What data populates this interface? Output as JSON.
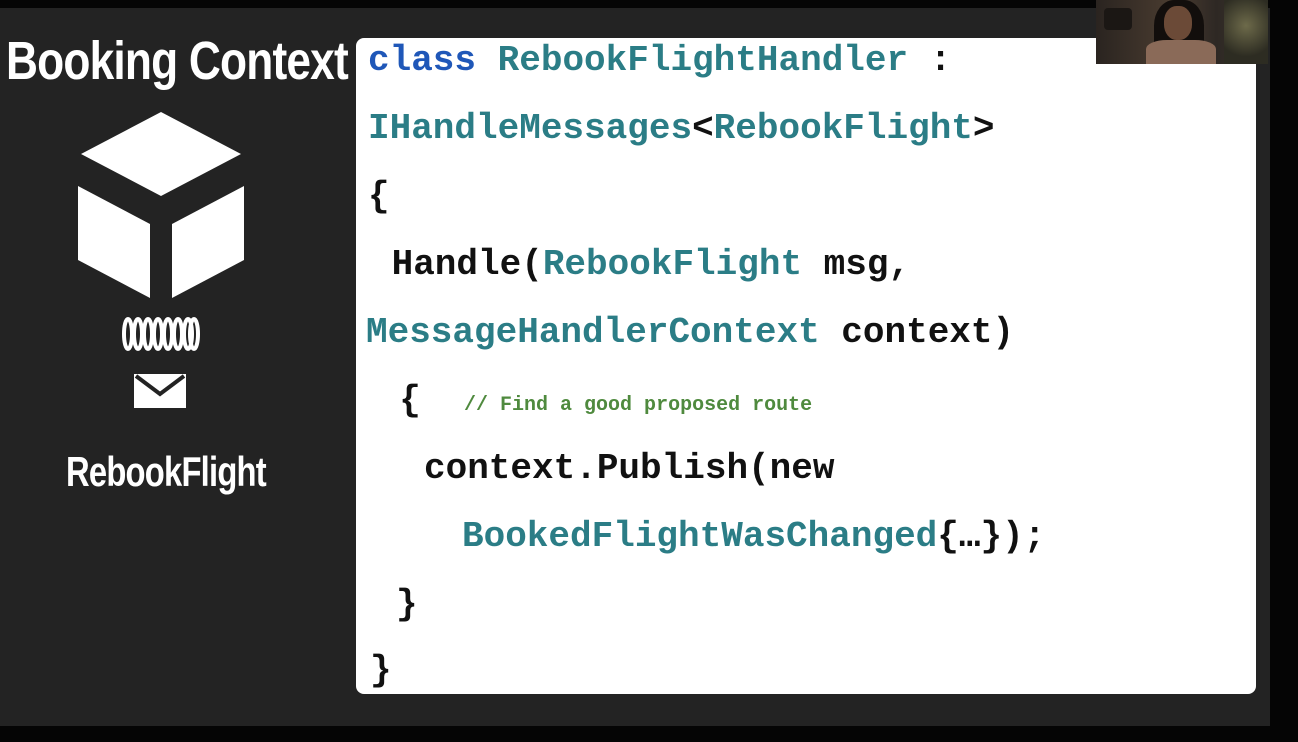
{
  "slide": {
    "title": "Booking Context",
    "message_label": "RebookFlight"
  },
  "code": {
    "line1": {
      "kw": "class",
      "type": "RebookFlightHandler",
      "rest": " :"
    },
    "line2": {
      "type": "IHandleMessages",
      "open": "<",
      "generic": "RebookFlight",
      "close": ">"
    },
    "line3": "{",
    "line4": {
      "pre": " Handle(",
      "type": "RebookFlight",
      "rest": " msg,"
    },
    "line5": {
      "type": "MessageHandlerContext",
      "rest": " context)"
    },
    "line6": {
      "brace": "  {",
      "comment": "// Find a good proposed route"
    },
    "line7": "context.Publish(new",
    "line8": {
      "type": "BookedFlightWasChanged",
      "rest": "{…});"
    },
    "line9": "}",
    "line10": "}"
  },
  "colors": {
    "keyword": "#1f57b8",
    "type": "#2b7d86",
    "comment": "#4f8a3e",
    "slide_background": "#232323",
    "code_background": "#ffffff"
  },
  "icons": [
    "cube-icon",
    "coil-icon",
    "envelope-icon"
  ],
  "webcam": {
    "visible": true
  }
}
